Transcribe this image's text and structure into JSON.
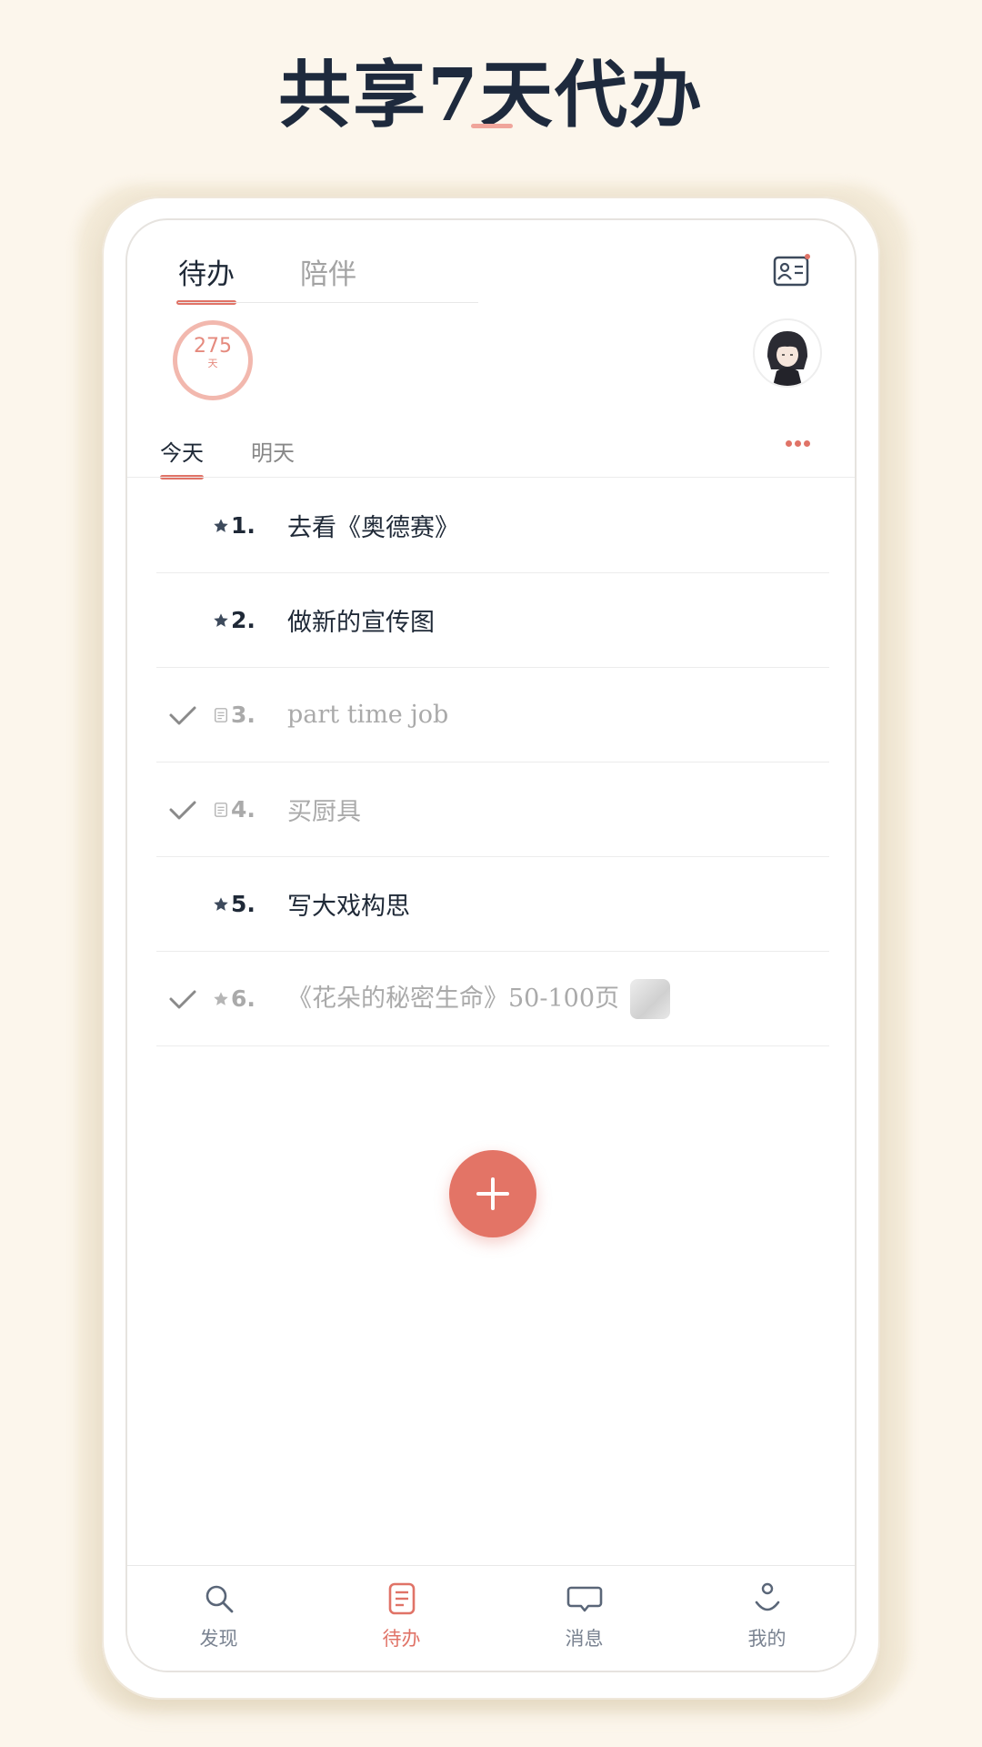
{
  "headline": "共享7天代办",
  "top_tabs": [
    {
      "label": "待办",
      "active": true
    },
    {
      "label": "陪伴",
      "active": false
    }
  ],
  "days_badge": {
    "value": "275",
    "unit": "天"
  },
  "day_tabs": [
    {
      "label": "今天",
      "active": true
    },
    {
      "label": "明天",
      "active": false
    }
  ],
  "todos": [
    {
      "number": "1.",
      "text": "去看《奥德赛》",
      "done": false,
      "marker": "star-icon"
    },
    {
      "number": "2.",
      "text": "做新的宣传图",
      "done": false,
      "marker": "star-icon"
    },
    {
      "number": "3.",
      "text": "part time job",
      "done": true,
      "marker": "note-icon"
    },
    {
      "number": "4.",
      "text": "买厨具",
      "done": true,
      "marker": "note-icon"
    },
    {
      "number": "5.",
      "text": "写大戏构思",
      "done": false,
      "marker": "star-icon"
    },
    {
      "number": "6.",
      "text": "《花朵的秘密生命》50-100页",
      "done": true,
      "marker": "star-icon",
      "has_image": true
    }
  ],
  "bottom_nav": [
    {
      "label": "发现",
      "icon": "search-icon",
      "active": false
    },
    {
      "label": "待办",
      "icon": "list-icon",
      "active": true
    },
    {
      "label": "消息",
      "icon": "message-icon",
      "active": false
    },
    {
      "label": "我的",
      "icon": "profile-icon",
      "active": false
    }
  ],
  "colors": {
    "accent": "#e07367",
    "background": "#fcf6ec",
    "title": "#1e2a3d"
  }
}
